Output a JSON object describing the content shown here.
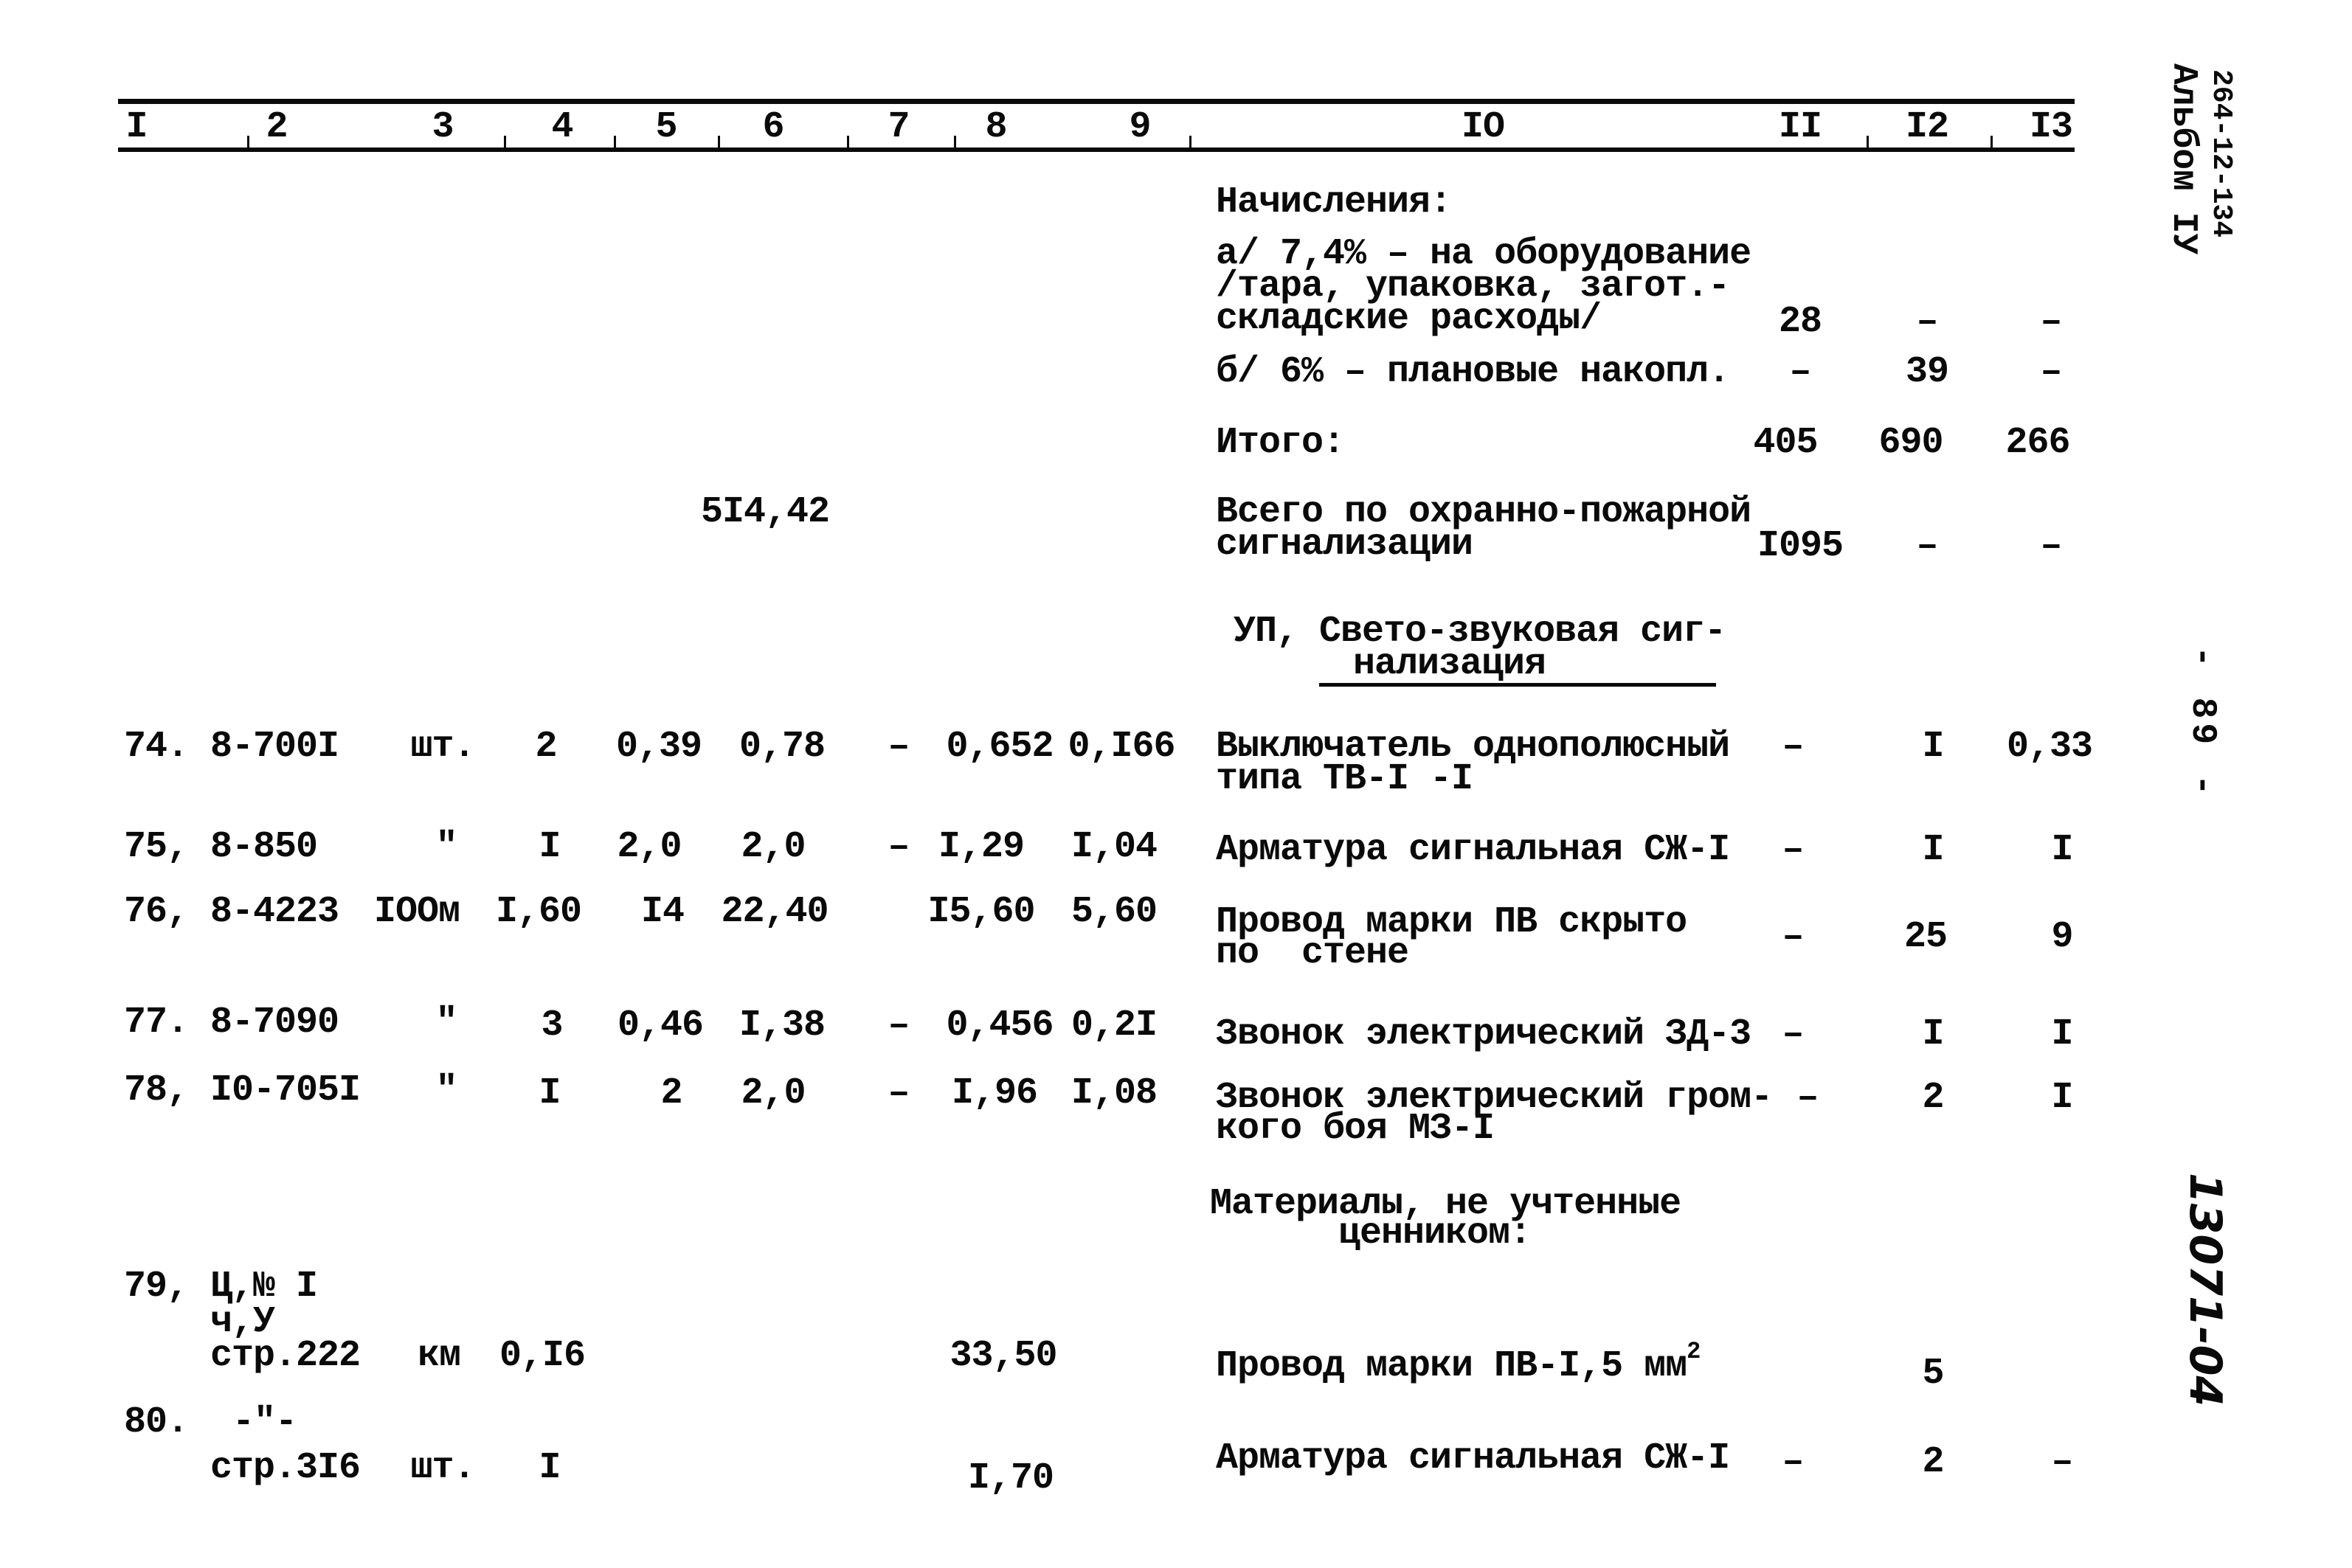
{
  "margin": {
    "album_code": "264-12-134",
    "album_label": "Альбом IУ",
    "page_number": "- 89 -",
    "handwritten_id": "13071-04"
  },
  "header_columns": [
    "I",
    "2",
    "3",
    "4",
    "5",
    "6",
    "7",
    "8",
    "9",
    "IO",
    "II",
    "I2",
    "I3"
  ],
  "charges": {
    "title": "Начисления:",
    "a_line1": "а/ 7,4% – на оборудование",
    "a_line2": "/тара, упаковка, загот.-",
    "a_line3": "складские расходы/",
    "a_c11": "28",
    "a_c12": "–",
    "a_c13": "–",
    "b_line": "б/ 6% – плановые накопл.",
    "b_c11": "–",
    "b_c12": "39",
    "b_c13": "–"
  },
  "total": {
    "label": "Итого:",
    "c11": "405",
    "c12": "690",
    "c13": "266"
  },
  "grand_total": {
    "c6": "5I4,42",
    "label_line1": "Всего по охранно-пожарной",
    "label_line2": "сигнализации",
    "c11": "I095",
    "c12": "–",
    "c13": "–"
  },
  "section": {
    "line1": "УП, Свето-звуковая сиг-",
    "line2": "нализация"
  },
  "rows": [
    {
      "num": "74.",
      "code": "8-700I",
      "unit": "шт.",
      "qty": "2",
      "c5": "0,39",
      "c6": "0,78",
      "c7": "–",
      "c8": "0,652",
      "c9": "0,I66",
      "desc1": "Выключатель однополюсный",
      "desc2": "типа ТВ-I -I",
      "c11": "–",
      "c12": "I",
      "c13": "0,33"
    },
    {
      "num": "75,",
      "code": "8-850",
      "unit": "\"",
      "qty": "I",
      "c5": "2,0",
      "c6": "2,0",
      "c7": "–",
      "c8": "I,29",
      "c9": "I,04",
      "desc1": "Арматура сигнальная СЖ-I",
      "desc2": "",
      "c11": "–",
      "c12": "I",
      "c13": "I"
    },
    {
      "num": "76,",
      "code": "8-4223",
      "unit": "IOOм",
      "qty": "I,60",
      "c5": "I4",
      "c6": "22,40",
      "c7": "",
      "c8": "I5,60",
      "c9": "5,60",
      "desc1": "Провод марки ПВ скрыто",
      "desc2": "по  стене",
      "c11": "–",
      "c12": "25",
      "c13": "9"
    },
    {
      "num": "77.",
      "code": "8-7090",
      "unit": "\"",
      "qty": "3",
      "c5": "0,46",
      "c6": "I,38",
      "c7": "–",
      "c8": "0,456",
      "c9": "0,2I",
      "desc1": "Звонок электрический ЗД-3",
      "desc2": "",
      "c11": "–",
      "c12": "I",
      "c13": "I"
    },
    {
      "num": "78,",
      "code": "I0-705I",
      "unit": "\"",
      "qty": "I",
      "c5": "2",
      "c6": "2,0",
      "c7": "–",
      "c8": "I,96",
      "c9": "I,08",
      "desc1": "Звонок электрический гром-",
      "desc2": "кого боя МЗ-I",
      "c11": "–",
      "c12": "2",
      "c13": "I"
    }
  ],
  "materials": {
    "line1": "Материалы, не учтенные",
    "line2": "ценником:"
  },
  "materials_rows": [
    {
      "num": "79,",
      "code1": "Ц,№ I",
      "code2": "ч,У",
      "code3": "стр.222",
      "unit": "км",
      "qty": "0,I6",
      "c8": "33,50",
      "desc": "Провод марки ПВ-I,5 мм",
      "desc_sup": "2",
      "c11": "",
      "c12": "5",
      "c13": ""
    },
    {
      "num": "80.",
      "code1": "-\"-",
      "code3": "стр.3I6",
      "unit": "шт.",
      "qty": "I",
      "c8": "I,70",
      "desc": "Арматура сигнальная СЖ-I",
      "c11": "–",
      "c12": "2",
      "c13": "–"
    }
  ]
}
